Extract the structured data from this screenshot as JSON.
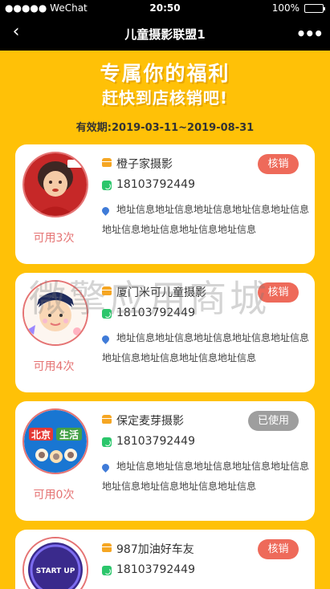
{
  "status_bar": {
    "carrier": "●●●●● WeChat",
    "time": "20:50",
    "battery": "100%",
    "battery_level": 1.0
  },
  "nav": {
    "title": "儿童摄影联盟1",
    "back_icon": "back-chevron-icon",
    "more_icon": "more-dots-icon"
  },
  "banner": {
    "line1": "专属你的福利",
    "line2": "赶快到店核销吧!"
  },
  "validity": "有效期:2019-03-11~2019-08-31",
  "watermark": "微擎应用商城",
  "stores": [
    {
      "name": "橙子家摄影",
      "phone": "18103792449",
      "address": "地址信息地址信息地址信息地址信息地址信息地址信息地址信息地址信息地址信息",
      "uses": "可用3次",
      "action": "核销",
      "action_state": "active"
    },
    {
      "name": "厦门米可儿童摄影",
      "phone": "18103792449",
      "address": "地址信息地址信息地址信息地址信息地址信息地址信息地址信息地址信息地址信息",
      "uses": "可用4次",
      "action": "核销",
      "action_state": "active"
    },
    {
      "name": "保定麦芽摄影",
      "phone": "18103792449",
      "address": "地址信息地址信息地址信息地址信息地址信息地址信息地址信息地址信息地址信息",
      "uses": "可用0次",
      "action": "已使用",
      "action_state": "used",
      "avatar_text": [
        "北京",
        "生活"
      ]
    },
    {
      "name": "987加油好车友",
      "phone": "18103792449",
      "action": "核销",
      "action_state": "active",
      "avatar_text": "START UP"
    }
  ],
  "colors": {
    "background": "#FFC107",
    "accent_red": "#EE6A5A",
    "used_gray": "#9E9E9E",
    "phone_green": "#2BC66B"
  }
}
